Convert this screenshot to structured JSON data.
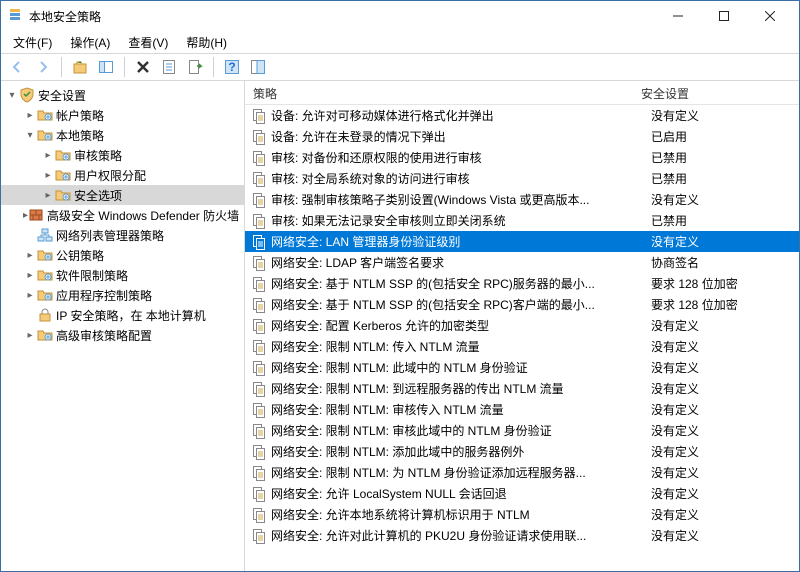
{
  "window": {
    "title": "本地安全策略"
  },
  "menu": {
    "file": "文件(F)",
    "action": "操作(A)",
    "view": "查看(V)",
    "help": "帮助(H)"
  },
  "tree": {
    "root": "安全设置",
    "items": [
      {
        "label": "帐户策略",
        "indent": 1,
        "twisty": ">",
        "icon": "folder"
      },
      {
        "label": "本地策略",
        "indent": 1,
        "twisty": "v",
        "icon": "folder"
      },
      {
        "label": "审核策略",
        "indent": 2,
        "twisty": ">",
        "icon": "folder"
      },
      {
        "label": "用户权限分配",
        "indent": 2,
        "twisty": ">",
        "icon": "folder"
      },
      {
        "label": "安全选项",
        "indent": 2,
        "twisty": ">",
        "icon": "folder",
        "selected": true
      },
      {
        "label": "高级安全 Windows Defender 防火墙",
        "indent": 1,
        "twisty": ">",
        "icon": "brick"
      },
      {
        "label": "网络列表管理器策略",
        "indent": 1,
        "twisty": "",
        "icon": "network"
      },
      {
        "label": "公钥策略",
        "indent": 1,
        "twisty": ">",
        "icon": "folder"
      },
      {
        "label": "软件限制策略",
        "indent": 1,
        "twisty": ">",
        "icon": "folder"
      },
      {
        "label": "应用程序控制策略",
        "indent": 1,
        "twisty": ">",
        "icon": "folder"
      },
      {
        "label": "IP 安全策略，在 本地计算机",
        "indent": 1,
        "twisty": "",
        "icon": "lock"
      },
      {
        "label": "高级审核策略配置",
        "indent": 1,
        "twisty": ">",
        "icon": "folder"
      }
    ]
  },
  "list": {
    "headers": {
      "policy": "策略",
      "setting": "安全设置"
    },
    "rows": [
      {
        "policy": "设备: 允许对可移动媒体进行格式化并弹出",
        "setting": "没有定义"
      },
      {
        "policy": "设备: 允许在未登录的情况下弹出",
        "setting": "已启用"
      },
      {
        "policy": "审核: 对备份和还原权限的使用进行审核",
        "setting": "已禁用"
      },
      {
        "policy": "审核: 对全局系统对象的访问进行审核",
        "setting": "已禁用"
      },
      {
        "policy": "审核: 强制审核策略子类别设置(Windows Vista 或更高版本...",
        "setting": "没有定义"
      },
      {
        "policy": "审核: 如果无法记录安全审核则立即关闭系统",
        "setting": "已禁用"
      },
      {
        "policy": "网络安全: LAN 管理器身份验证级别",
        "setting": "没有定义",
        "selected": true
      },
      {
        "policy": "网络安全: LDAP 客户端签名要求",
        "setting": "协商签名"
      },
      {
        "policy": "网络安全: 基于 NTLM SSP 的(包括安全 RPC)服务器的最小...",
        "setting": "要求 128 位加密"
      },
      {
        "policy": "网络安全: 基于 NTLM SSP 的(包括安全 RPC)客户端的最小...",
        "setting": "要求 128 位加密"
      },
      {
        "policy": "网络安全: 配置 Kerberos 允许的加密类型",
        "setting": "没有定义"
      },
      {
        "policy": "网络安全: 限制 NTLM: 传入 NTLM 流量",
        "setting": "没有定义"
      },
      {
        "policy": "网络安全: 限制 NTLM: 此域中的 NTLM 身份验证",
        "setting": "没有定义"
      },
      {
        "policy": "网络安全: 限制 NTLM: 到远程服务器的传出 NTLM 流量",
        "setting": "没有定义"
      },
      {
        "policy": "网络安全: 限制 NTLM: 审核传入 NTLM 流量",
        "setting": "没有定义"
      },
      {
        "policy": "网络安全: 限制 NTLM: 审核此域中的 NTLM 身份验证",
        "setting": "没有定义"
      },
      {
        "policy": "网络安全: 限制 NTLM: 添加此域中的服务器例外",
        "setting": "没有定义"
      },
      {
        "policy": "网络安全: 限制 NTLM: 为 NTLM 身份验证添加远程服务器...",
        "setting": "没有定义"
      },
      {
        "policy": "网络安全: 允许 LocalSystem NULL 会话回退",
        "setting": "没有定义"
      },
      {
        "policy": "网络安全: 允许本地系统将计算机标识用于 NTLM",
        "setting": "没有定义"
      },
      {
        "policy": "网络安全: 允许对此计算机的 PKU2U 身份验证请求使用联...",
        "setting": "没有定义"
      }
    ]
  }
}
